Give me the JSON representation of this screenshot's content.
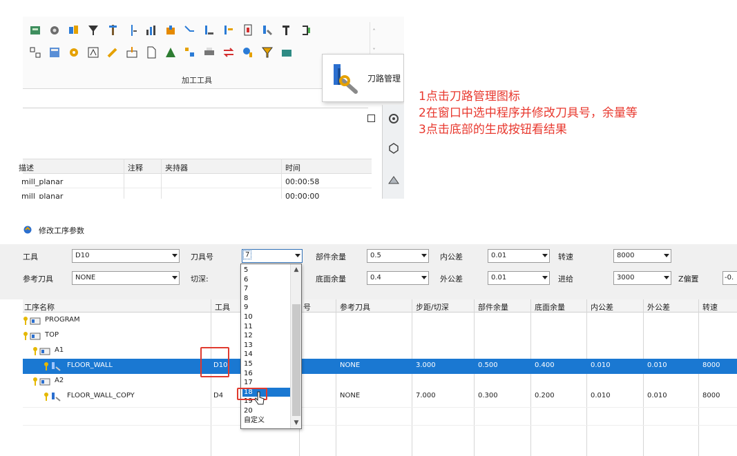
{
  "ribbon": {
    "group_label": "加工工具",
    "tooltip_label": "刀路管理"
  },
  "outline_table": {
    "headers": [
      "描述",
      "注释",
      "夹持器",
      "时间"
    ],
    "rows": [
      {
        "desc": "mill_planar",
        "time": "00:00:58"
      },
      {
        "desc": "mill_planar",
        "time": "00:00:00"
      }
    ]
  },
  "instructions": [
    "1点击刀路管理图标",
    "2在窗口中选中程序并修改刀具号，余量等",
    "3点击底部的生成按钮看结果"
  ],
  "dialog": {
    "title": "修改工序参数",
    "params": {
      "tool_label": "工具",
      "tool_value": "D10",
      "tool_no_label": "刀具号",
      "tool_no_value": "7",
      "part_stock_label": "部件余量",
      "part_stock_value": "0.5",
      "intol_label": "内公差",
      "intol_value": "0.01",
      "speed_label": "转速",
      "speed_value": "8000",
      "ref_tool_label": "参考刀具",
      "ref_tool_value": "NONE",
      "cut_depth_label": "切深:",
      "floor_stock_label": "底面余量",
      "floor_stock_value": "0.4",
      "outtol_label": "外公差",
      "outtol_value": "0.01",
      "feed_label": "进给",
      "feed_value": "3000",
      "z_offset_label": "Z偏置",
      "z_offset_value": "-0."
    },
    "grid": {
      "headers": [
        "工序名称",
        "工具",
        "号",
        "参考刀具",
        "步距/切深",
        "部件余量",
        "底面余量",
        "内公差",
        "外公差",
        "转速"
      ],
      "rows": [
        {
          "name": "PROGRAM"
        },
        {
          "name": "TOP"
        },
        {
          "name": "A1"
        },
        {
          "name": "FLOOR_WALL",
          "tool": "D10",
          "ref": "NONE",
          "step": "3.000",
          "part": "0.500",
          "floor": "0.400",
          "intol": "0.010",
          "outtol": "0.010",
          "speed": "8000"
        },
        {
          "name": "A2"
        },
        {
          "name": "FLOOR_WALL_COPY",
          "tool": "D4",
          "ref": "NONE",
          "step": "7.000",
          "part": "0.300",
          "floor": "0.200",
          "intol": "0.010",
          "outtol": "0.010",
          "speed": "8000"
        }
      ]
    },
    "dropdown": {
      "options": [
        "5",
        "6",
        "7",
        "8",
        "9",
        "10",
        "11",
        "12",
        "13",
        "14",
        "15",
        "16",
        "17",
        "18",
        "19",
        "20",
        "自定义"
      ],
      "highlighted": "18"
    }
  },
  "colors": {
    "instruction_red": "#e8382e",
    "selection_blue": "#1a78d2",
    "highlight_box": "#e03a2e"
  }
}
